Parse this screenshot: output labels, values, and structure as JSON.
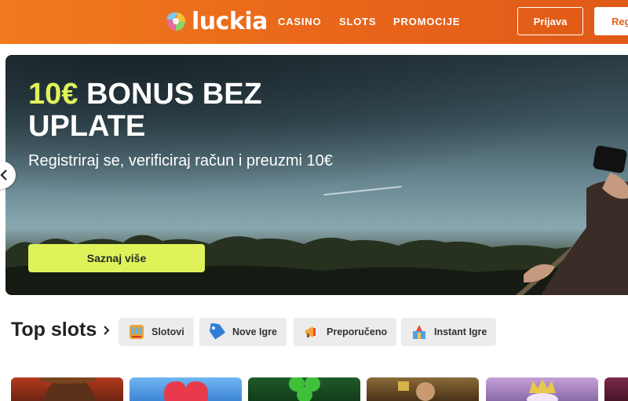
{
  "header": {
    "logo_text": "luckia",
    "nav": [
      "CASINO",
      "SLOTS",
      "PROMOCIJE"
    ],
    "login_label": "Prijava",
    "register_label": "Reg"
  },
  "hero": {
    "title_accent": "10€",
    "title_rest_line1": " BONUS BEZ",
    "title_line2": "UPLATE",
    "subtitle": "Registriraj se, verificiraj račun i preuzmi 10€",
    "cta_label": "Saznaj više"
  },
  "top_slots": {
    "title": "Top slots",
    "chips": [
      "Slotovi",
      "Nove Igre",
      "Preporučeno",
      "Instant Igre"
    ]
  },
  "colors": {
    "header": "#ea6a1b",
    "accent": "#dff25a",
    "chip_bg": "#ececec"
  }
}
